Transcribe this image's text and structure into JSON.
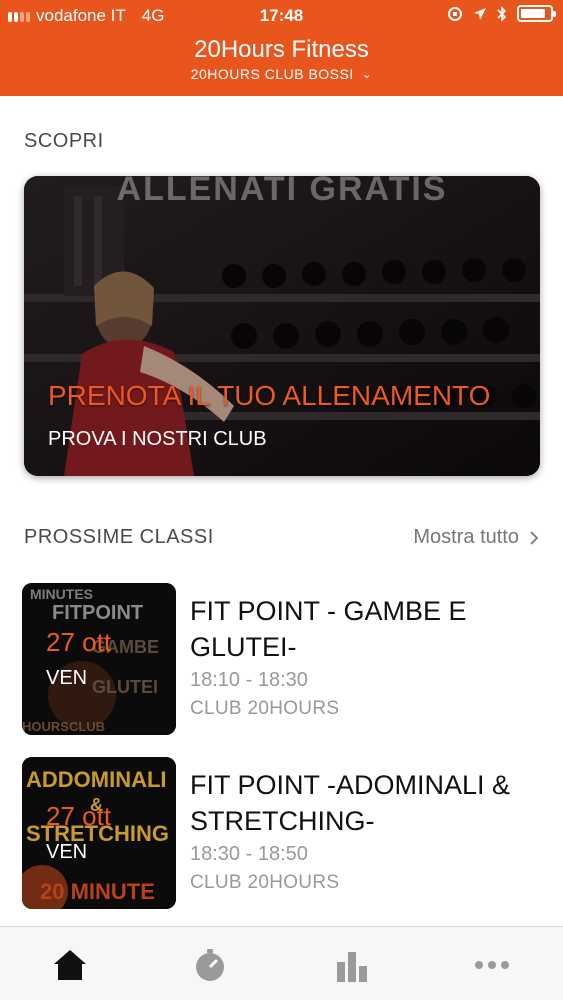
{
  "status_bar": {
    "carrier": "vodafone IT",
    "network": "4G",
    "time": "17:48",
    "battery_level": 0.85
  },
  "header": {
    "title": "20Hours Fitness",
    "club": "20HOURS CLUB BOSSI"
  },
  "discover": {
    "section_title": "SCOPRI",
    "promo": {
      "watermark": "ALLENATI GRATIS",
      "title": "PRENOTA IL TUO ALLENAMENTO",
      "subtitle": "PROVA I NOSTRI CLUB"
    }
  },
  "upcoming": {
    "section_title": "PROSSIME CLASSI",
    "show_all_label": "Mostra tutto",
    "classes": [
      {
        "thumb_text": [
          "MINUTES",
          "FITPOINT",
          "GAMBE",
          "GLUTEI",
          "HOURSCLUB"
        ],
        "date": "27 ott",
        "day": "VEN",
        "name": "FIT POINT - GAMBE E GLUTEI-",
        "time": "18:10 - 18:30",
        "club": "CLUB 20HOURS"
      },
      {
        "thumb_text": [
          "ADDOMINALI",
          "&",
          "STRETCHING",
          "20 MINUTE"
        ],
        "date": "27 ott",
        "day": "VEN",
        "name": "FIT POINT -ADOMINALI & STRETCHING-",
        "time": "18:30 - 18:50",
        "club": "CLUB 20HOURS"
      }
    ]
  },
  "tab_bar": {
    "tabs": [
      {
        "icon": "home-icon",
        "active": true
      },
      {
        "icon": "stopwatch-icon",
        "active": false
      },
      {
        "icon": "bar-chart-icon",
        "active": false
      },
      {
        "icon": "more-dots-icon",
        "active": false
      }
    ]
  },
  "colors": {
    "brand": "#e8561e",
    "accent_text": "#ea5a22",
    "muted": "#999999"
  }
}
